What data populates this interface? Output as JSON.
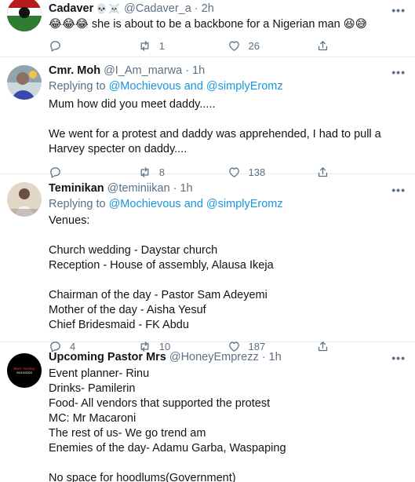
{
  "tweets": [
    {
      "name": "Cadaver",
      "badges": "💀☠️",
      "handle": "@Cadaver_a",
      "separator": "·",
      "time": "2h",
      "text": "😂😂😂 she is about to be a backbone for a Nigerian man 😆😅",
      "retweets": "1",
      "likes": "26",
      "colors": {
        "avatar_bg": "#c62828"
      }
    },
    {
      "name": "Cmr. Moh",
      "handle": "@I_Am_marwa",
      "separator": "·",
      "time": "1h",
      "reply_prefix": "Replying to",
      "mentions": "@Mochievous and @simplyEromz",
      "line1": "Mum how did you meet daddy.....",
      "line2": "We went for a protest and daddy was apprehended, I had to pull a Harvey specter on daddy....",
      "retweets": "8",
      "likes": "138"
    },
    {
      "name": "Teminikan",
      "handle": "@teminiikan",
      "separator": "·",
      "time": "1h",
      "reply_prefix": "Replying to",
      "mentions": "@Mochievous and @simplyEromz",
      "lines": [
        "Venues:",
        "",
        "Church wedding - Daystar church",
        "Reception - House of assembly, Alausa Ikeja",
        "",
        "Chairman of the day - Pastor Sam Adeyemi",
        "Mother of the day - Aisha Yesuf",
        "Chief Bridesmaid - FK Abdu"
      ],
      "replies": "4",
      "retweets": "10",
      "likes": "187"
    },
    {
      "name": "Upcoming Pastor Mrs",
      "handle": "@HoneyEmprezz",
      "separator": "·",
      "time": "1h",
      "avatar_text": "Black Tuesday 20/10/2020",
      "lines": [
        "Event planner- Rinu",
        "Drinks- Pamilerin",
        "Food- All vendors that supported the protest",
        "MC: Mr Macaroni",
        "The rest of us- We go trend am",
        "Enemies of the day- Adamu Garba, Waspaping",
        "",
        "No space for hoodlums(Government)"
      ]
    }
  ],
  "more_label": "•••"
}
